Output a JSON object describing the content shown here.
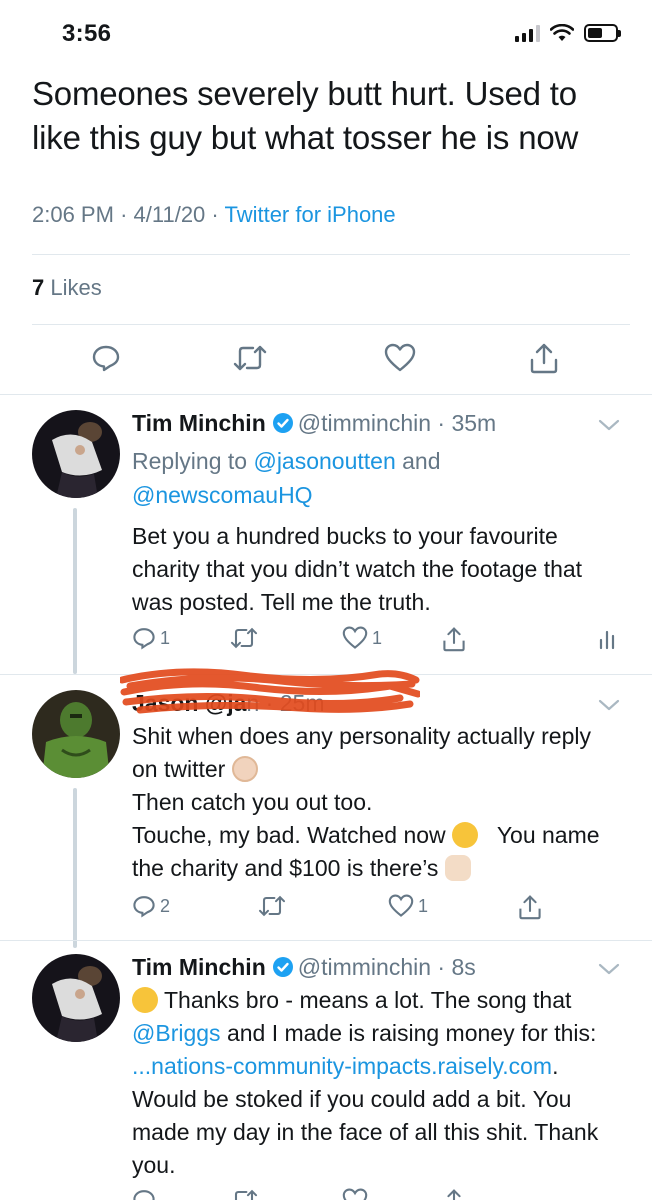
{
  "status_bar": {
    "time": "3:56"
  },
  "main_tweet": {
    "text": "Someones severely butt hurt. Used to like this guy but what tosser he is now",
    "time": "2:06 PM",
    "date": "4/11/20",
    "separator": "·",
    "source": "Twitter for iPhone",
    "likes_count": "7",
    "likes_label": "Likes",
    "actions": [
      "reply-icon",
      "retweet-icon",
      "like-icon",
      "share-icon"
    ]
  },
  "replies": [
    {
      "name": "Tim Minchin",
      "handle": "@timminchin",
      "time": "35m",
      "replying_to_label": "Replying to",
      "mention1": "@jasonoutten",
      "and_label": "and",
      "mention2": "@newscomauHQ",
      "body": "Bet you a hundred bucks to your favourite charity that you didn’t watch the footage that was posted. Tell me the truth.",
      "reply_count": "1",
      "like_count": "1"
    },
    {
      "name_redacted": "Jason @ja",
      "handle_tail": "n",
      "time": "25m",
      "body_line1": "Shit when does any personality actually reply on twitter",
      "body_line2": "Then catch you out too.",
      "body_line3a": "Touche, my bad. Watched now",
      "body_line3b": "You name the charity and $100 is there’s",
      "reply_count": "2",
      "like_count": "1"
    },
    {
      "name": "Tim Minchin",
      "handle": "@timminchin",
      "time": "8s",
      "body_a": "Thanks bro - means a lot. The song that",
      "mention": "@Briggs",
      "body_b": "and I made is raising money for this:",
      "link": "...nations-community-impacts.raisely.com",
      "body_c": ". Would be stoked if you could add a bit. You made my day in the face of all this shit. Thank you."
    }
  ],
  "colors": {
    "link": "#1b95e0",
    "secondary_text": "#657786",
    "divider": "#e1e8ed",
    "thread_line": "#ccd6dd",
    "redaction": "#e24a1c"
  }
}
